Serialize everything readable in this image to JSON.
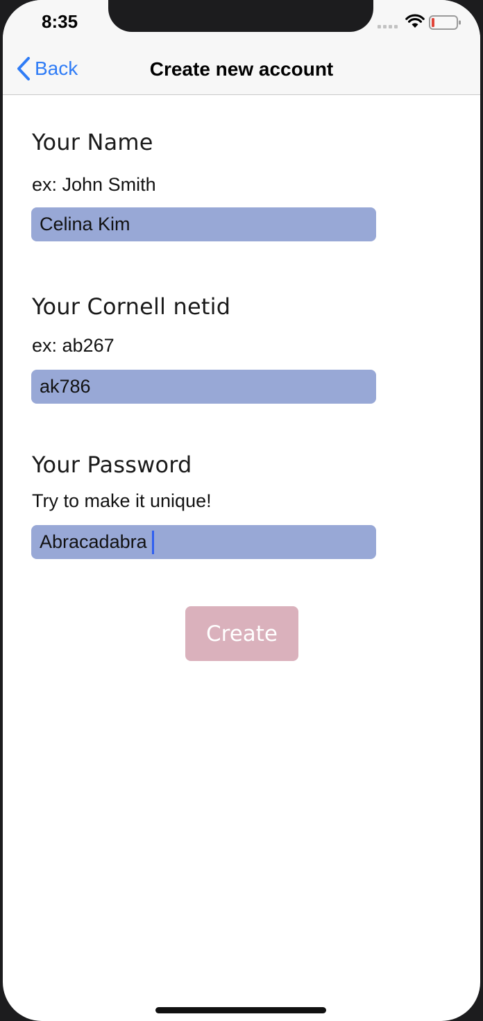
{
  "status_bar": {
    "time": "8:35",
    "icons": [
      "cellular-signal-icon",
      "wifi-icon",
      "battery-low-icon"
    ],
    "battery_color": "#e0453a"
  },
  "nav": {
    "back_label": "Back",
    "title": "Create new account",
    "accent_color": "#2f7cf6"
  },
  "form": {
    "name": {
      "title": "Your Name",
      "hint": "ex: John Smith",
      "value": "Celina Kim"
    },
    "netid": {
      "title": "Your Cornell netid",
      "hint": "ex: ab267",
      "value": "ak786"
    },
    "password": {
      "title": "Your Password",
      "hint": "Try to make it unique!",
      "value": "Abracadabra"
    },
    "field_color": "#98a8d6"
  },
  "create_button": {
    "label": "Create",
    "color": "#dab1bc"
  }
}
